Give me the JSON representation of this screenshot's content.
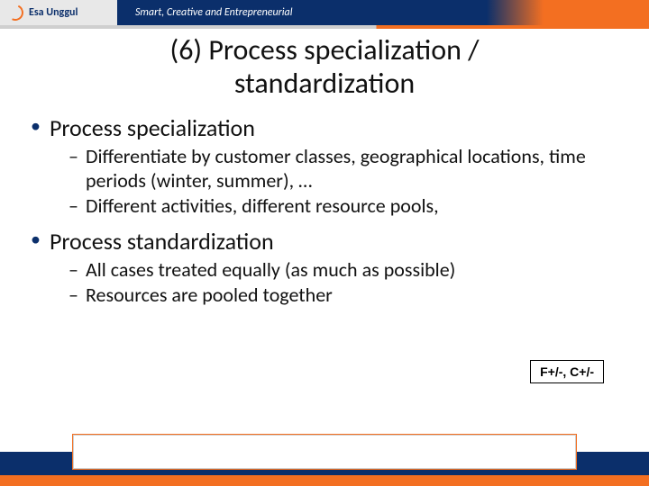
{
  "header": {
    "logo_text": "Esa Unggul",
    "tagline": "Smart, Creative and Entrepreneurial"
  },
  "title_line1": "(6) Process specialization /",
  "title_line2": "standardization",
  "sections": [
    {
      "heading": "Process specialization",
      "subs": [
        "Differentiate by customer classes, geographical locations, time periods (winter, summer), …",
        "Different activities, different resource pools,"
      ]
    },
    {
      "heading": "Process standardization",
      "subs": [
        "All cases treated equally (as much as possible)",
        "Resources are pooled together"
      ]
    }
  ],
  "badge": "F+/-, C+/-"
}
